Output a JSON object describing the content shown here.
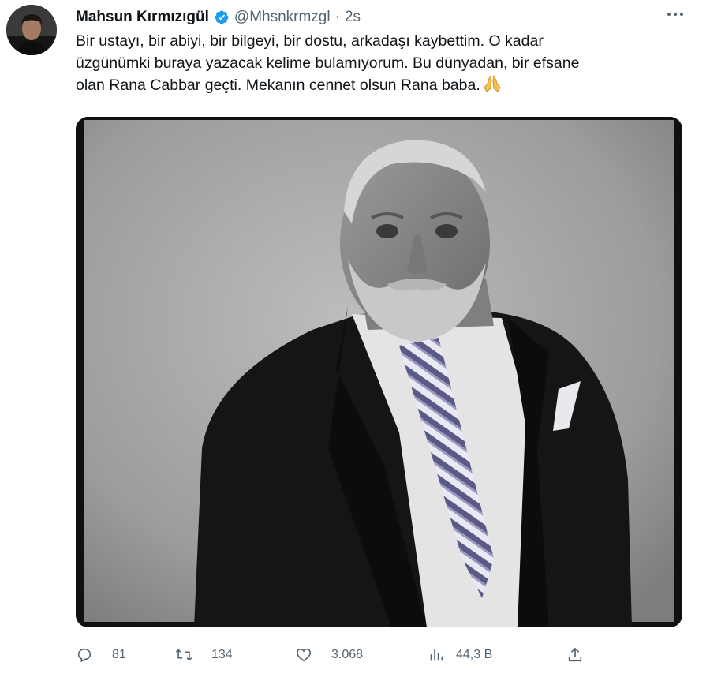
{
  "tweet": {
    "author_name": "Mahsun Kırmızıgül",
    "verified_icon": "verified-badge-icon",
    "handle": "@Mhsnkrmzgl",
    "separator": "·",
    "time": "2s",
    "text_lines": [
      "Bir ustayı, bir abiyi, bir bilgeyi, bir dostu, arkadaşı kaybettim. O kadar",
      "üzgünümki buraya yazacak kelime bulamıyorum. Bu dünyadan, bir efsane",
      "olan Rana Cabbar geçti. Mekanın cennet olsun Rana baba."
    ],
    "emoji": "🙏",
    "media_icon": "photo",
    "accent_color": "#1d9bf0"
  },
  "actions": {
    "reply": {
      "icon": "reply-icon",
      "count": "81"
    },
    "retweet": {
      "icon": "retweet-icon",
      "count": "134"
    },
    "like": {
      "icon": "like-icon",
      "count": "3.068"
    },
    "views": {
      "icon": "views-icon",
      "count": "44,3 B"
    },
    "share": {
      "icon": "share-icon"
    }
  }
}
